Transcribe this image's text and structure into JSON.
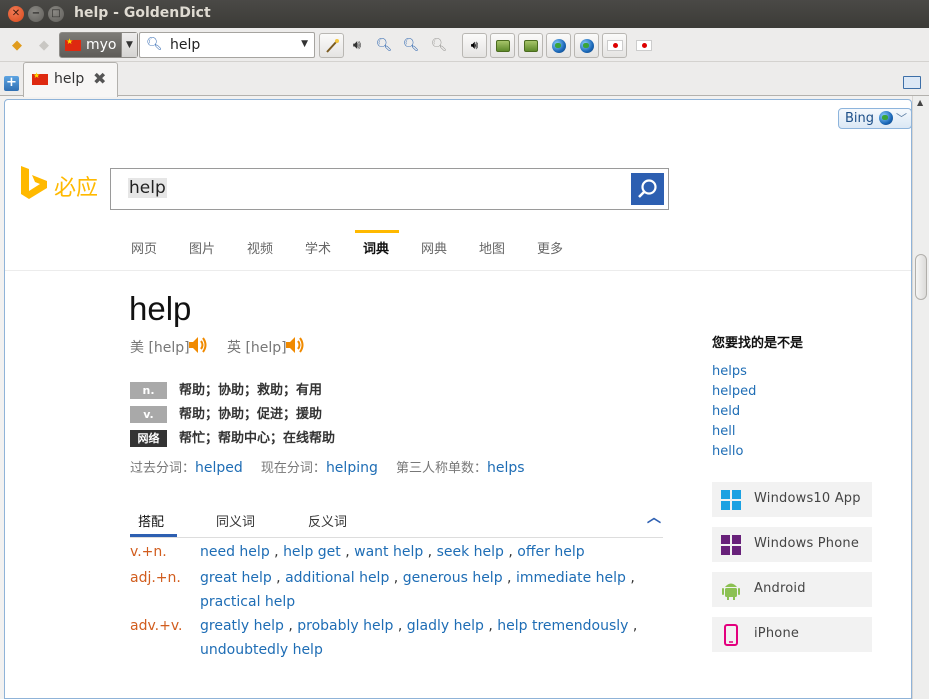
{
  "window": {
    "title": "help - GoldenDict"
  },
  "toolbar": {
    "group_name": "myo",
    "search_value": "help",
    "search_placeholder": ""
  },
  "tab": {
    "label": "help"
  },
  "dict_selector": {
    "label": "Bing"
  },
  "bing": {
    "brand": "必应",
    "query": "help",
    "nav": [
      "网页",
      "图片",
      "视频",
      "学术",
      "词典",
      "网典",
      "地图",
      "更多"
    ],
    "active_nav": "词典",
    "headword": "help",
    "pron_us": "美 [help]",
    "pron_uk": "英 [help]",
    "definitions": [
      {
        "pos": "n.",
        "text": "帮助；协助；救助；有用"
      },
      {
        "pos": "v.",
        "text": "帮助；协助；促进；援助"
      },
      {
        "pos": "网络",
        "text": "帮忙；帮助中心；在线帮助"
      }
    ],
    "forms": {
      "past_label": "过去分词：",
      "past": "helped",
      "present_label": "现在分词：",
      "present": "helping",
      "third_label": "第三人称单数：",
      "third": "helps"
    },
    "collocation_tabs": [
      "搭配",
      "同义词",
      "反义词"
    ],
    "collocations": [
      {
        "key": "v.+n.",
        "items": [
          "need help",
          "help get",
          "want help",
          "seek help",
          "offer help"
        ]
      },
      {
        "key": "adj.+n.",
        "items": [
          "great help",
          "additional help",
          "generous help",
          "immediate help",
          "practical help"
        ]
      },
      {
        "key": "adv.+v.",
        "items": [
          "greatly help",
          "probably help",
          "gladly help",
          "help tremendously",
          "undoubtedly help"
        ]
      }
    ],
    "suggest_title": "您要找的是不是",
    "suggestions": [
      "helps",
      "helped",
      "held",
      "hell",
      "hello"
    ],
    "apps": [
      {
        "label": "Windows10 App",
        "icon": "windows-icon",
        "color": "#1ba1e2"
      },
      {
        "label": "Windows Phone",
        "icon": "windows-phone-icon",
        "color": "#68217a"
      },
      {
        "label": "Android",
        "icon": "android-icon",
        "color": "#8cc152"
      },
      {
        "label": "iPhone",
        "icon": "iphone-icon",
        "color": "#e3007e"
      }
    ],
    "cutoff_text": "……………………"
  },
  "colors": {
    "accent": "#2d5fb1",
    "bing_yellow": "#ffb900",
    "link": "#1e6db5",
    "collocation_key": "#d15d1e"
  }
}
